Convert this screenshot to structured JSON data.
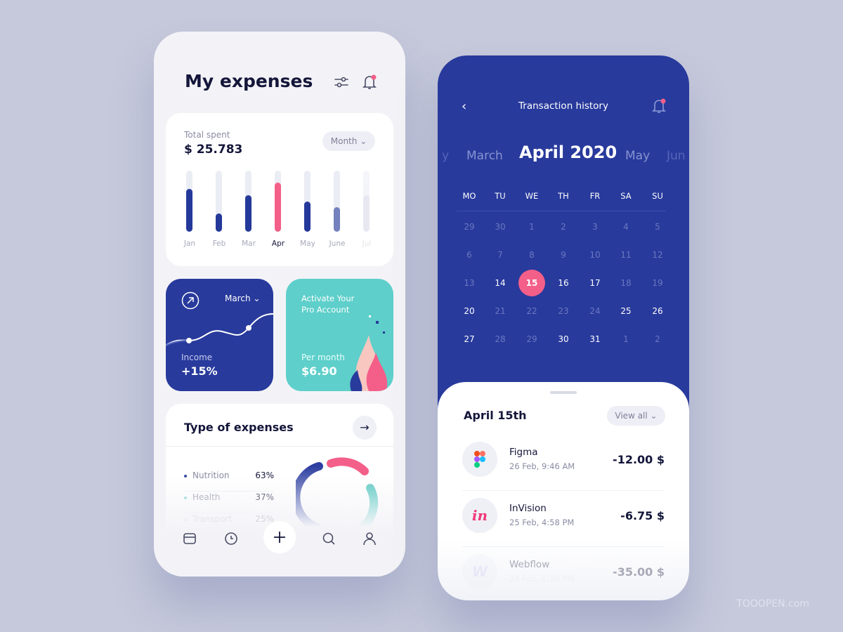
{
  "left": {
    "title": "My expenses",
    "total": {
      "label": "Total spent",
      "value": "$ 25.783",
      "period": "Month"
    },
    "chart_data": {
      "type": "bar",
      "categories": [
        "Jan",
        "Feb",
        "Mar",
        "Apr",
        "May",
        "June",
        "Jul"
      ],
      "values": [
        0.7,
        0.3,
        0.6,
        0.8,
        0.5,
        0.4,
        0.6
      ],
      "highlight": "Apr",
      "colors": {
        "bar": "#24399a",
        "highlight": "#f45f89"
      }
    },
    "income": {
      "month": "March",
      "label": "Income",
      "value": "+15%"
    },
    "pro": {
      "title": "Activate Your Pro Account",
      "label": "Per month",
      "value": "$6.90"
    },
    "types": {
      "title": "Type of expenses",
      "items": [
        {
          "name": "Nutrition",
          "pct": "63%",
          "color": "#3a4aa8"
        },
        {
          "name": "Health",
          "pct": "37%",
          "color": "#7fd3cf"
        },
        {
          "name": "Transport",
          "pct": "25%",
          "color": "#c5c7d6"
        }
      ]
    },
    "nav": [
      "wallet-icon",
      "clock-icon",
      "plus-icon",
      "search-icon",
      "user-icon"
    ]
  },
  "right": {
    "title": "Transaction history",
    "months": [
      "y",
      "March",
      "April 2020",
      "May",
      "Jun"
    ],
    "weekdays": [
      "MO",
      "TU",
      "WE",
      "TH",
      "FR",
      "SA",
      "SU"
    ],
    "weeks": [
      [
        "29",
        "30",
        "1",
        "2",
        "3",
        "4",
        "5"
      ],
      [
        "6",
        "7",
        "8",
        "9",
        "10",
        "11",
        "12"
      ],
      [
        "13",
        "14",
        "15",
        "16",
        "17",
        "18",
        "19"
      ],
      [
        "20",
        "21",
        "22",
        "23",
        "24",
        "25",
        "26"
      ],
      [
        "27",
        "28",
        "29",
        "30",
        "31",
        "1",
        "2"
      ]
    ],
    "bright": [
      "14",
      "16",
      "17",
      "20",
      "25",
      "26",
      "27",
      "30",
      "31"
    ],
    "selected": "15",
    "day_title": "April 15th",
    "view_all": "View all",
    "transactions": [
      {
        "name": "Figma",
        "date": "26 Feb, 9:46 AM",
        "amount": "-12.00 $"
      },
      {
        "name": "InVision",
        "date": "25 Feb, 4:58 PM",
        "amount": "-6.75 $",
        "logo": "in"
      },
      {
        "name": "Webflow",
        "date": "24 Feb, 1:20 PM",
        "amount": "-35.00 $",
        "logo": "W"
      }
    ]
  },
  "watermark": "TOOOPEN.com"
}
